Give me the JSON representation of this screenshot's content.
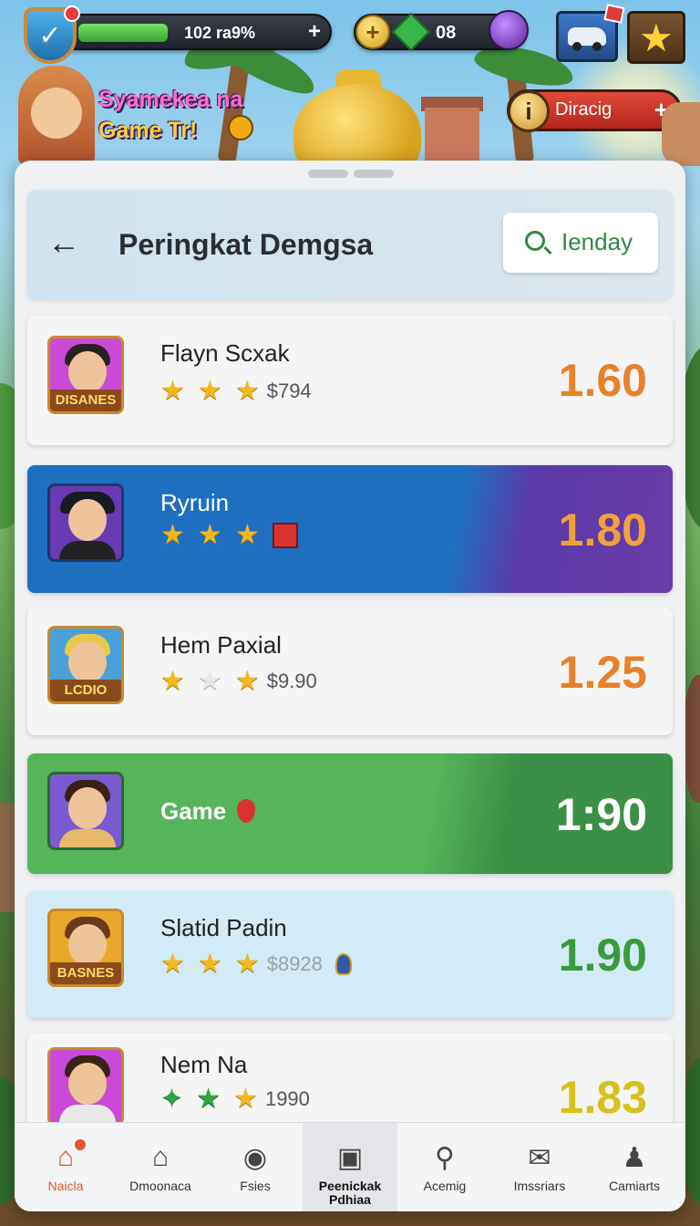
{
  "hud": {
    "xp_text": "102 ra9%",
    "xp_progress": 0.32,
    "gems_text": "08",
    "drag_label": "Diracig",
    "drag_icon_glyph": "i"
  },
  "promo": {
    "line1": "Syamekea na",
    "line2": "Game Tr!"
  },
  "header": {
    "title": "Peringkat Demgsa",
    "search_label": "Ienday"
  },
  "rows": [
    {
      "name": "Flayn Scxak",
      "stars": 3,
      "price": "$794",
      "score": "1.60",
      "badge": "DISANES",
      "score_color": "#e8822a",
      "hair": "#2a2020",
      "body": "#2a5a9a",
      "bg": "#c94ad6"
    },
    {
      "name": "Ryruin",
      "stars": 3,
      "price": "",
      "score": "1.80",
      "badge": "",
      "score_color": "#f0a23a",
      "hair": "#1a1a22",
      "body": "#222",
      "bg": "#6a3ab5"
    },
    {
      "name": "Hem Paxial",
      "stars": 1,
      "price": "$9.90",
      "score": "1.25",
      "badge": "LCDIO",
      "score_color": "#e8822a",
      "hair": "#e8c84a",
      "body": "#2f8a3f",
      "bg": "#4aa0d8"
    },
    {
      "name": "Game",
      "stars": 0,
      "price": "",
      "score": "1:90",
      "badge": "",
      "score_color": "#ffffff",
      "hair": "#3a2214",
      "body": "#e8b86a",
      "bg": "#7a5ad0"
    },
    {
      "name": "Slatid Padin",
      "stars": 3,
      "price": "$8928",
      "score": "1.90",
      "badge": "BASNES",
      "score_color": "#3a9a3f",
      "hair": "#6a3a1a",
      "body": "#1a3a6a",
      "bg": "#e8a82a"
    },
    {
      "name": "Nem Na",
      "stars": 3,
      "price": "1990",
      "score": "1.83",
      "badge": "",
      "score_color": "#d6c21a",
      "hair": "#3a2214",
      "body": "#e8e8e8",
      "bg": "#c94ad6"
    }
  ],
  "nav": [
    {
      "label": "Naicla",
      "icon": "home-icon"
    },
    {
      "label": "Dmoonaca",
      "icon": "house-outline-icon"
    },
    {
      "label": "Fsies",
      "icon": "camera-icon"
    },
    {
      "label": "Peenickak Pdhiaa",
      "icon": "box-icon"
    },
    {
      "label": "Acemig",
      "icon": "search-icon"
    },
    {
      "label": "Imssriars",
      "icon": "mail-icon"
    },
    {
      "label": "Camiarts",
      "icon": "user-icon"
    }
  ],
  "colors": {
    "accent_green": "#2f8a3f",
    "accent_orange": "#e8822a",
    "row_blue": "#1f6fc0",
    "row_green": "#56b45a"
  }
}
